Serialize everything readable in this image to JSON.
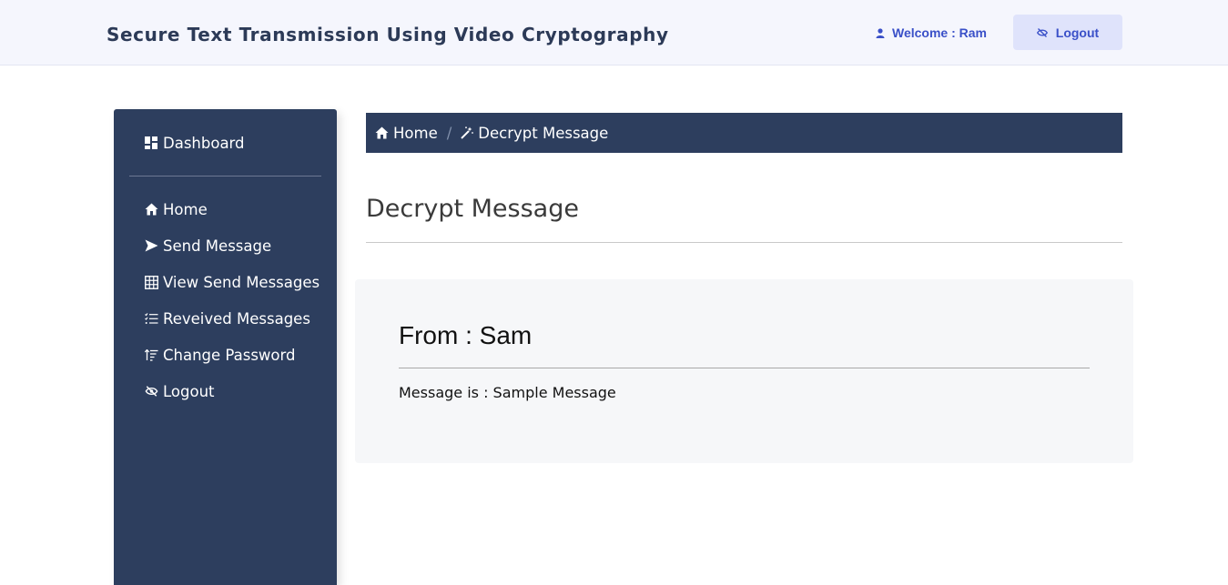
{
  "header": {
    "title": "Secure Text Transmission Using Video Cryptography",
    "welcome": "Welcome : Ram",
    "logout_label": "Logout",
    "accent": "#3a50c8"
  },
  "sidebar": {
    "background": "#2d3e5e",
    "dashboard": {
      "label": "Dashboard",
      "icon": "dashboard-icon"
    },
    "items": [
      {
        "label": "Home",
        "icon": "home-icon"
      },
      {
        "label": "Send Message",
        "icon": "send-icon"
      },
      {
        "label": "View Send Messages",
        "icon": "table-grid-icon"
      },
      {
        "label": "Reveived Messages",
        "icon": "list-icon"
      },
      {
        "label": "Change Password",
        "icon": "sort-icon"
      },
      {
        "label": "Logout",
        "icon": "eye-slash-icon"
      }
    ]
  },
  "breadcrumb": {
    "home": "Home",
    "separator": "/",
    "current": "Decrypt Message"
  },
  "main": {
    "title": "Decrypt Message",
    "from": "From : Sam",
    "message": "Message is : Sample Message"
  }
}
